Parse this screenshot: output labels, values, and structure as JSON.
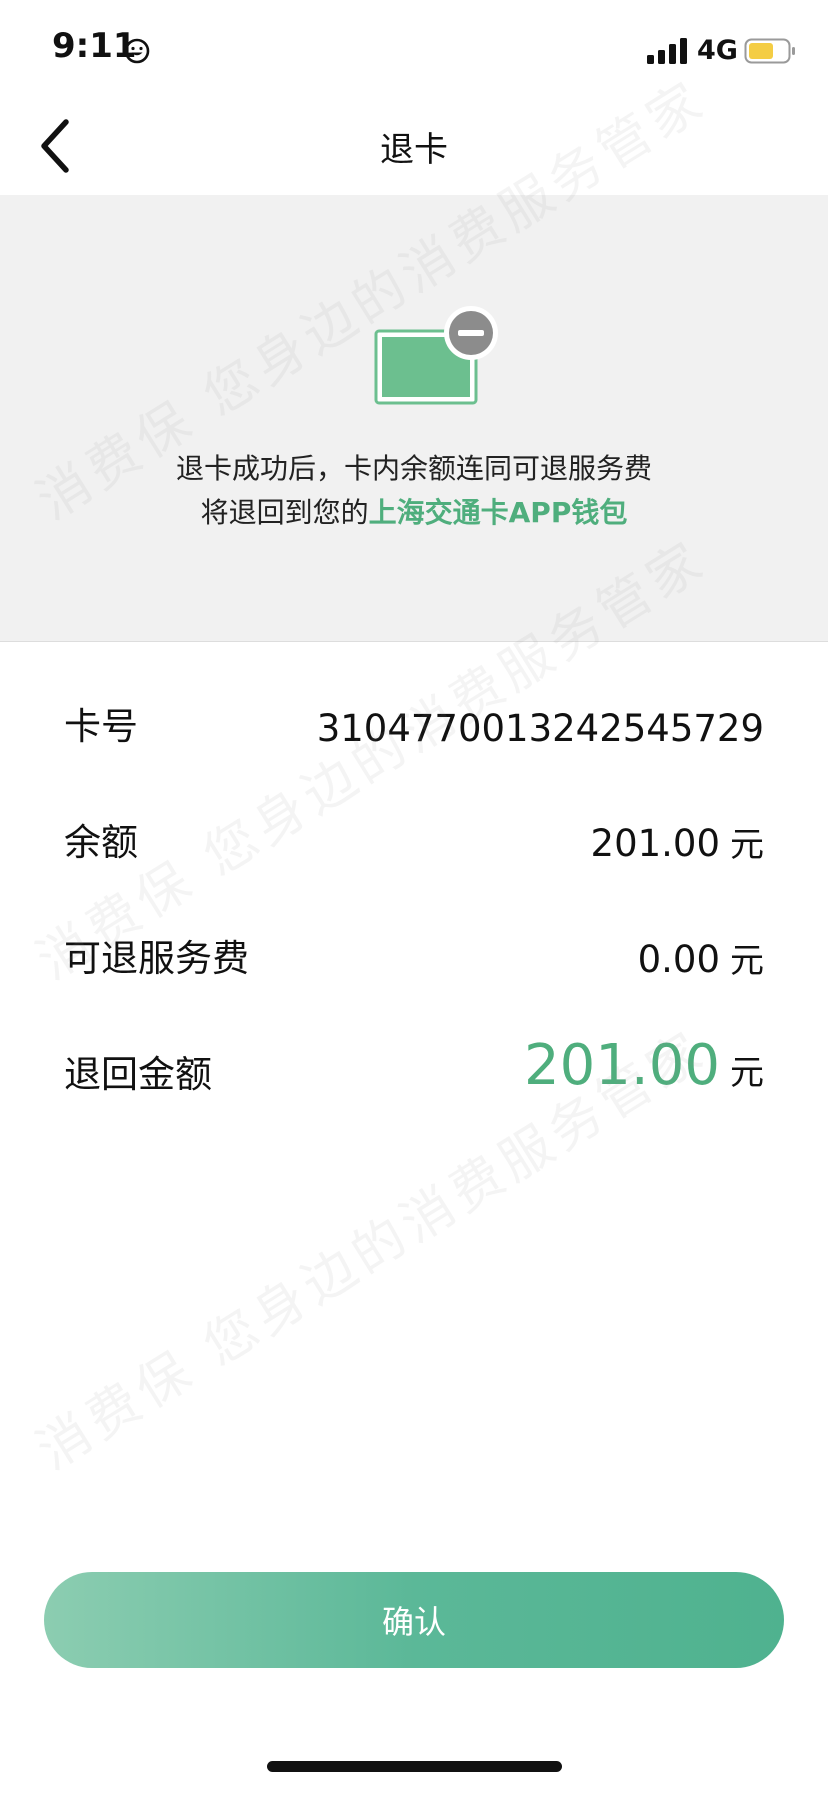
{
  "status_bar": {
    "time": "9:11",
    "network": "4G",
    "icons": [
      "smiley-icon",
      "signal-icon",
      "battery-icon"
    ],
    "battery_color": "#f4cd44"
  },
  "nav": {
    "title": "退卡",
    "back_icon": "chevron-left-icon"
  },
  "info": {
    "illustration_icon": "card-minus-icon",
    "line1": "退卡成功后，卡内余额连同可退服务费",
    "line2_prefix": "将退回到您的",
    "line2_highlight": "上海交通卡APP钱包"
  },
  "details": {
    "card_number_label": "卡号",
    "card_number_value": "3104770013242545729",
    "balance_label": "余额",
    "balance_value": "201.00",
    "refundable_fee_label": "可退服务费",
    "refundable_fee_value": "0.00",
    "refund_amount_label": "退回金额",
    "refund_amount_value": "201.00",
    "currency_unit": "元"
  },
  "actions": {
    "confirm_label": "确认"
  },
  "watermark": {
    "text": "消费保 您身边的消费服务管家"
  },
  "colors": {
    "accent": "#4fae7d",
    "panel_bg": "#f1f1f1",
    "button_start": "#8ccdb1",
    "button_end": "#4fb28f"
  }
}
